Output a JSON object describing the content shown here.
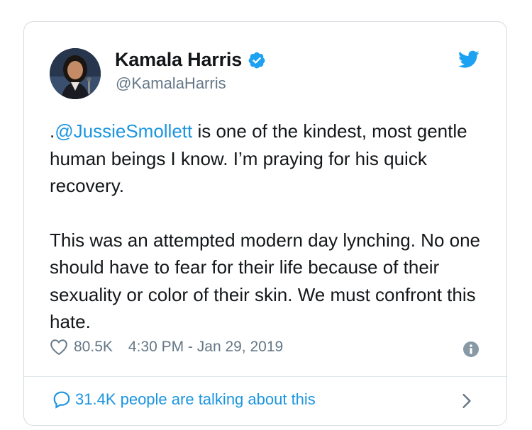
{
  "author": {
    "display_name": "Kamala Harris",
    "handle": "@KamalaHarris",
    "verified": true
  },
  "tweet": {
    "mention_prefix": ".",
    "mention": "@JussieSmollett",
    "paragraph1_rest": " is one of the kindest, most gentle human beings I know. I’m praying for his quick recovery.",
    "paragraph2": "This was an attempted modern day lynching. No one should have to fear for their life because of their sexuality or color of their skin. We must confront this hate."
  },
  "meta": {
    "likes": "80.5K",
    "timestamp": "4:30 PM - Jan 29, 2019"
  },
  "footer": {
    "talking": "31.4K people are talking about this"
  },
  "icons": {
    "brand": "twitter-bird-icon",
    "verified": "verified-badge-icon",
    "like": "heart-icon",
    "info": "info-icon",
    "reply": "speech-bubble-icon",
    "more": "chevron-right-icon"
  },
  "colors": {
    "accent": "#1da1f2",
    "link": "#1b95e0",
    "muted": "#657786",
    "text": "#14171a"
  }
}
